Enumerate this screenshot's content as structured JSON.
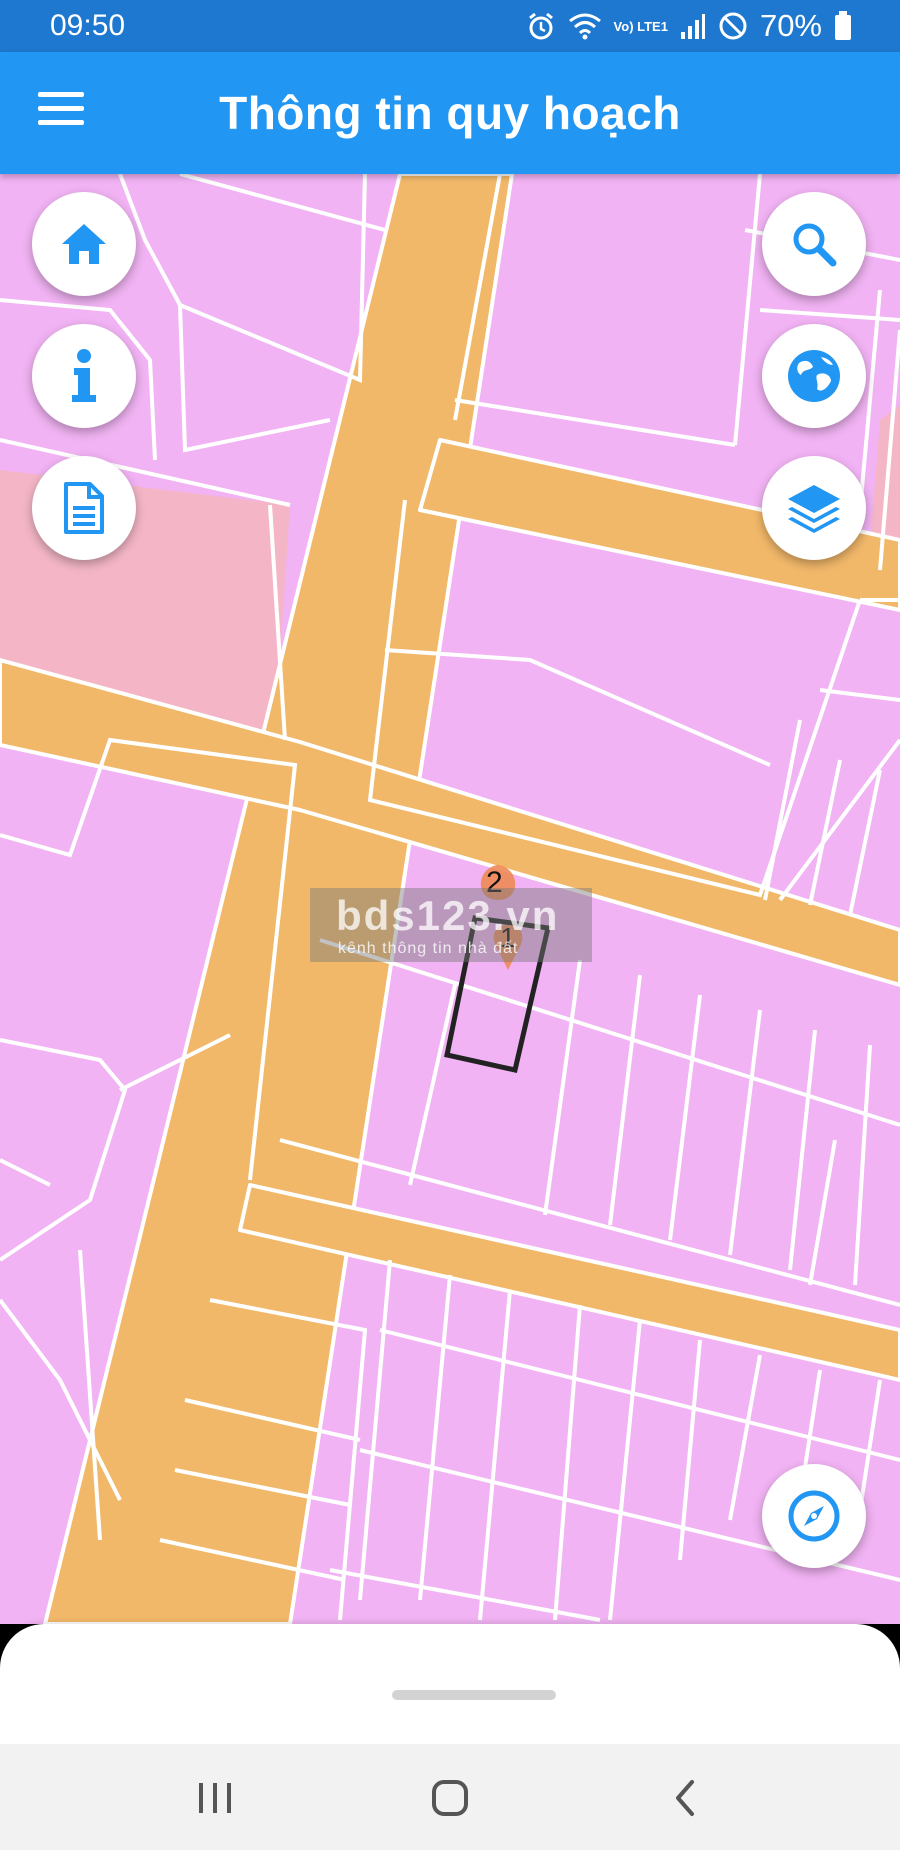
{
  "status_bar": {
    "time": "09:50",
    "network_label": "Vo) LTE1",
    "battery_percent": "70%",
    "icons": [
      "alarm-icon",
      "wifi-icon",
      "volte-icon",
      "signal-icon",
      "do-not-disturb-icon",
      "battery-icon"
    ]
  },
  "app_bar": {
    "title": "Thông tin quy hoạch",
    "menu_icon": "hamburger-menu-icon"
  },
  "left_buttons": [
    {
      "name": "home-button",
      "icon": "home-icon"
    },
    {
      "name": "info-button",
      "icon": "info-icon"
    },
    {
      "name": "document-button",
      "icon": "document-icon"
    }
  ],
  "right_buttons": [
    {
      "name": "search-button",
      "icon": "search-icon"
    },
    {
      "name": "globe-button",
      "icon": "globe-icon"
    },
    {
      "name": "layers-button",
      "icon": "layers-icon"
    },
    {
      "name": "compass-button",
      "icon": "compass-icon"
    }
  ],
  "map": {
    "colors": {
      "residential": "#f1b3f3",
      "road": "#f2b86a",
      "public_land": "#f4b6c6",
      "parcel_line": "#ffffff",
      "selected_parcel": "#222222",
      "marker": "#ee8a55"
    },
    "markers": [
      {
        "label": "2"
      },
      {
        "label": "1"
      }
    ],
    "watermark": {
      "name": "bds123.vn",
      "tagline": "kênh thông tin nhà đất"
    }
  },
  "bottom_sheet": {
    "handle": "drag-handle"
  },
  "nav_bar": {
    "buttons": [
      "recent-apps-icon",
      "home-icon",
      "back-icon"
    ]
  },
  "accent_color": "#2196f3"
}
